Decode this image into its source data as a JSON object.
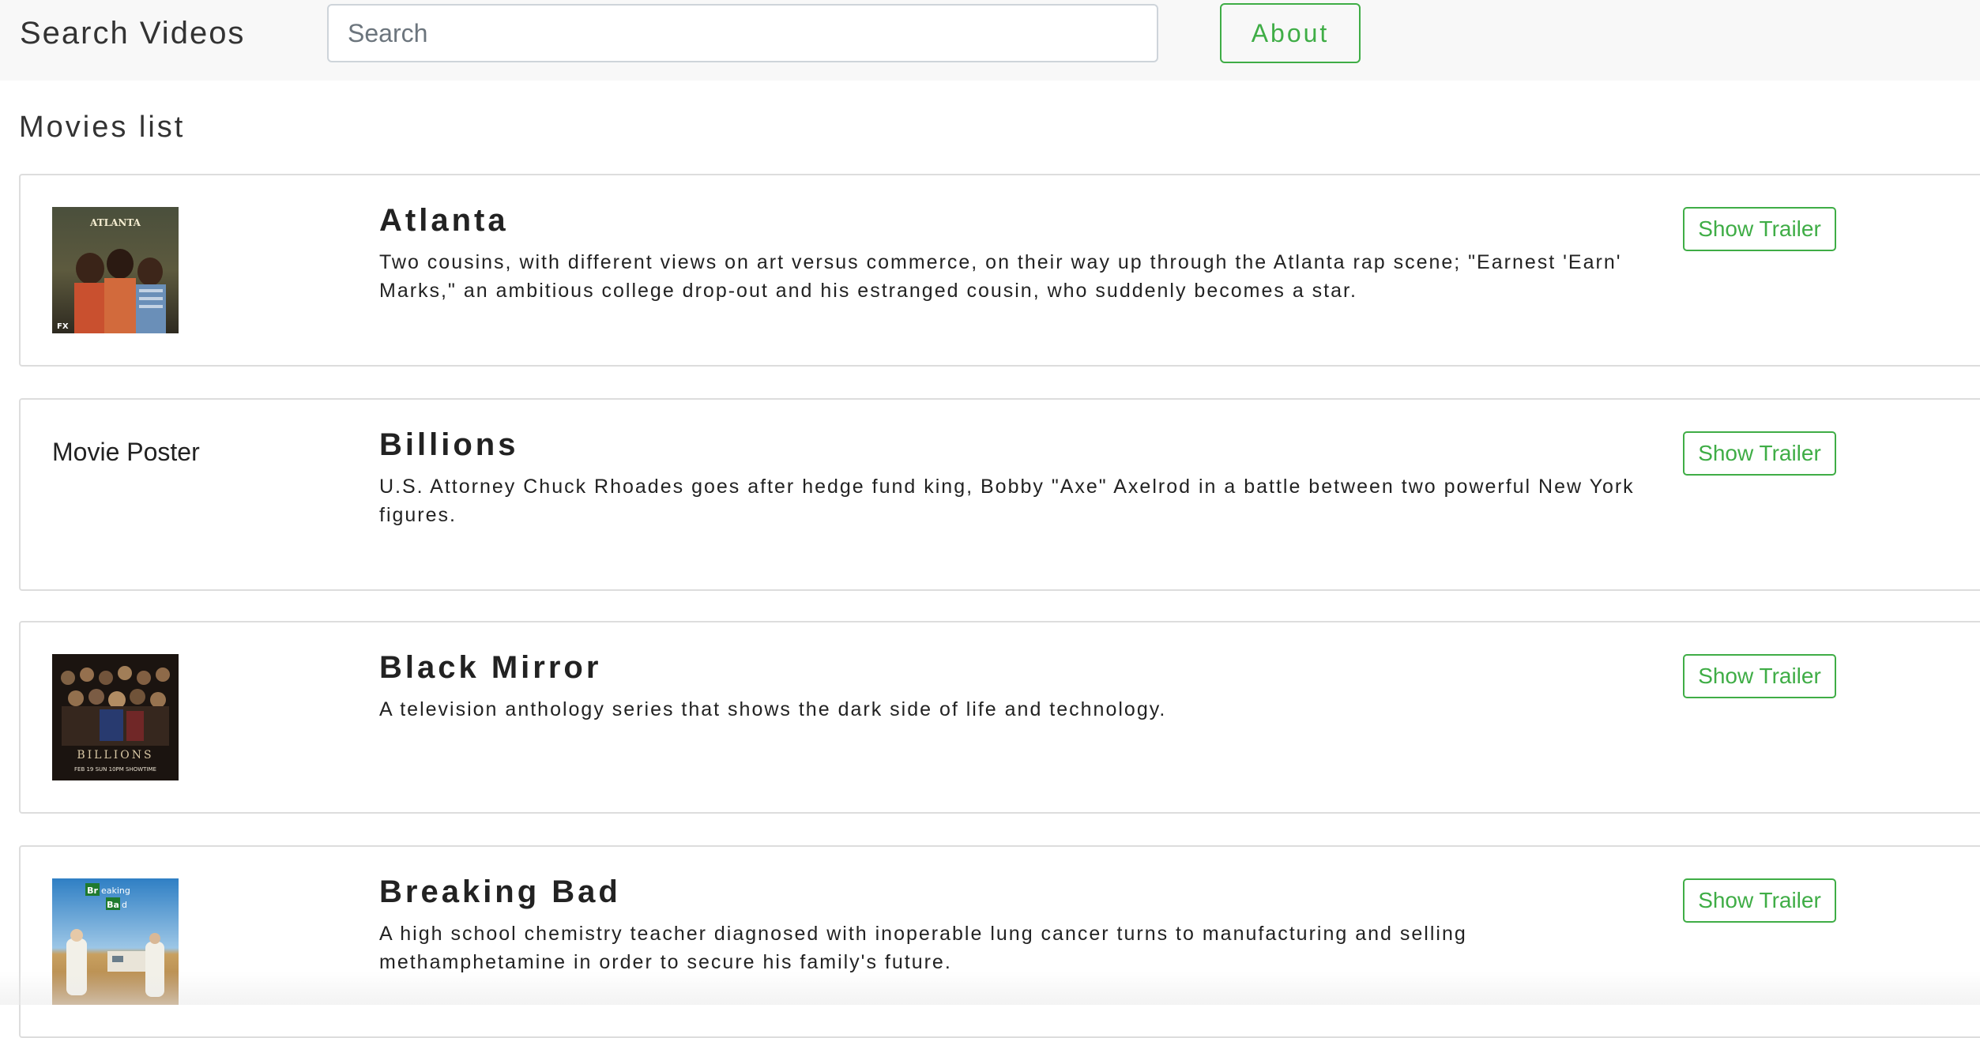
{
  "navbar": {
    "brand": "Search Videos",
    "search_placeholder": "Search",
    "search_value": "",
    "about_label": "About"
  },
  "main": {
    "section_title": "Movies list",
    "movies": [
      {
        "title": "Atlanta",
        "description": "Two cousins, with different views on art versus commerce, on their way up through the Atlanta rap scene; \"Earnest 'Earn' Marks,\" an ambitious college drop-out and his estranged cousin, who suddenly becomes a star.",
        "poster_text": "ATLANTA",
        "poster_badge": "FX",
        "trailer_label": "Show Trailer"
      },
      {
        "title": "Billions",
        "description": "U.S. Attorney Chuck Rhoades goes after hedge fund king, Bobby \"Axe\" Axelrod in a battle between two powerful New York figures.",
        "poster_alt": "Movie Poster",
        "trailer_label": "Show Trailer"
      },
      {
        "title": "Black Mirror",
        "description": "A television anthology series that shows the dark side of life and technology.",
        "poster_text": "BILLIONS",
        "poster_subtext": "FEB 19 SUN 10PM SHOWTIME",
        "trailer_label": "Show Trailer"
      },
      {
        "title": "Breaking Bad",
        "description": "A high school chemistry teacher diagnosed with inoperable lung cancer turns to manufacturing and selling methamphetamine in order to secure his family's future.",
        "poster_text_1": "Br",
        "poster_text_2": "eaking",
        "poster_text_3": "Ba",
        "poster_text_4": "d",
        "trailer_label": "Show Trailer"
      }
    ]
  },
  "colors": {
    "accent": "#3fad46",
    "navbar_bg": "#f8f8f8",
    "card_border": "#dddddd"
  }
}
